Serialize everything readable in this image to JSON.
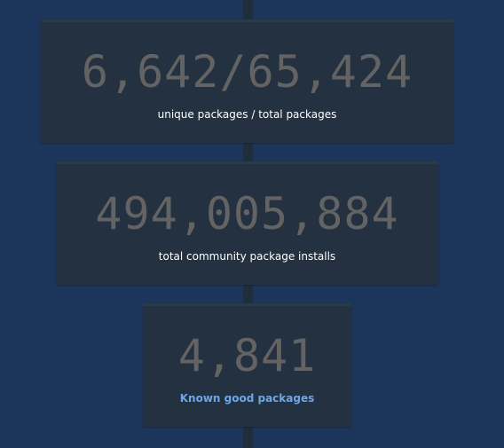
{
  "stats": [
    {
      "value": "6,642/65,424",
      "label": "unique packages / total packages"
    },
    {
      "value": "494,005,884",
      "label": "total community package installs"
    },
    {
      "value": "4,841",
      "label": "Known good packages"
    }
  ],
  "colors": {
    "background": "#1c365b",
    "card": "#233140",
    "value_text": "#636363",
    "label_text": "#ffffff",
    "link_text": "#6ea6e6"
  }
}
